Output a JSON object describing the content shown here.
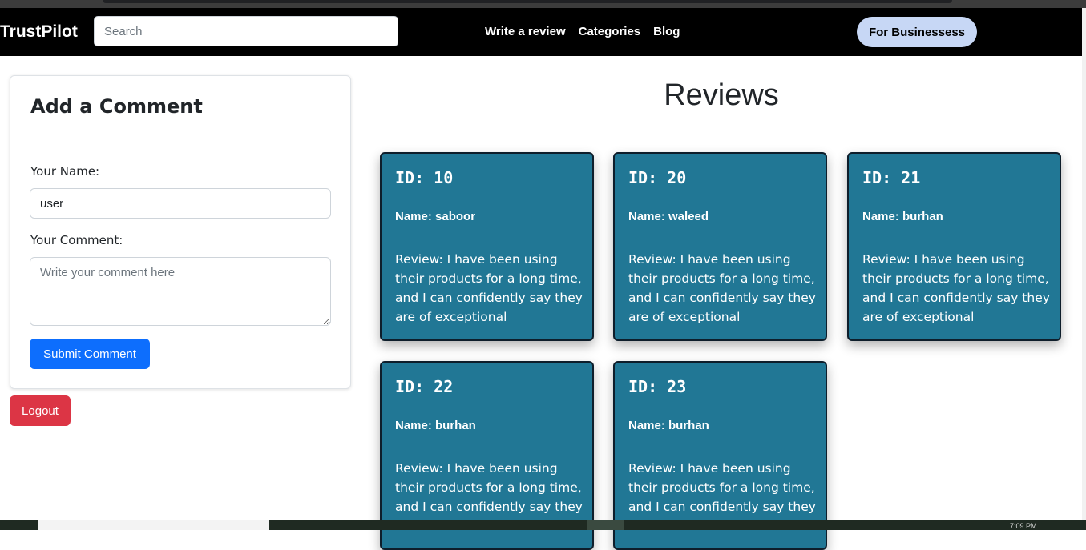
{
  "navbar": {
    "brand": "TrustPilot",
    "search_placeholder": "Search",
    "links": [
      "Write a review",
      "Categories",
      "Blog"
    ],
    "business_button": "For Businessess"
  },
  "comment_form": {
    "title": "Add a Comment",
    "name_label": "Your Name:",
    "name_value": "user",
    "comment_label": "Your Comment:",
    "comment_placeholder": "Write your comment here",
    "submit_label": "Submit Comment"
  },
  "logout_label": "Logout",
  "reviews": {
    "title": "Reviews",
    "items": [
      {
        "id": "ID: 10",
        "name": "Name: saboor",
        "review": "Review: I have been using their products for a long time, and I can confidently say they are of exceptional"
      },
      {
        "id": "ID: 20",
        "name": "Name: waleed",
        "review": "Review: I have been using their products for a long time, and I can confidently say they are of exceptional"
      },
      {
        "id": "ID: 21",
        "name": "Name: burhan",
        "review": "Review: I have been using their products for a long time, and I can confidently say they are of exceptional"
      },
      {
        "id": "ID: 22",
        "name": "Name: burhan",
        "review": "Review: I have been using their products for a long time, and I can confidently say they"
      },
      {
        "id": "ID: 23",
        "name": "Name: burhan",
        "review": "Review: I have been using their products for a long time, and I can confidently say they"
      }
    ]
  },
  "taskbar": {
    "clock": "7:09 PM"
  },
  "colors": {
    "card": "#217795",
    "submit": "#0d6efd",
    "logout": "#dc3545",
    "business": "#c7d7f5"
  }
}
